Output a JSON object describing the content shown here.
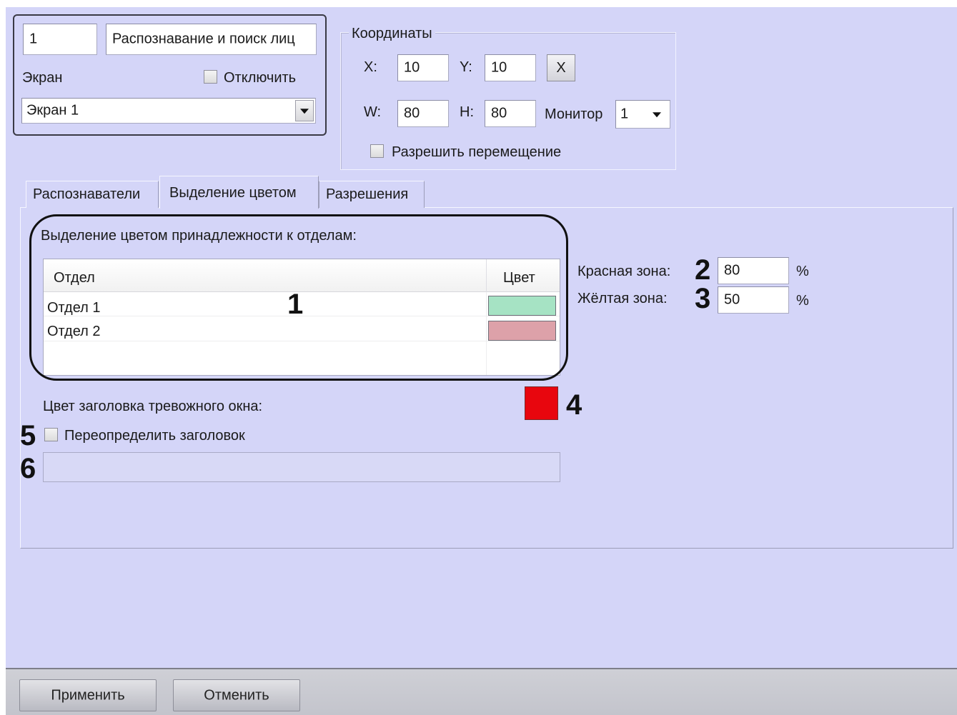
{
  "object": {
    "id": "1",
    "name": "Распознавание и поиск лиц",
    "screen_label": "Экран",
    "disable_label": "Отключить",
    "screen_value": "Экран 1"
  },
  "coords": {
    "title": "Координаты",
    "x_label": "X:",
    "x_value": "10",
    "y_label": "Y:",
    "y_value": "10",
    "clear_label": "X",
    "w_label": "W:",
    "w_value": "80",
    "h_label": "H:",
    "h_value": "80",
    "monitor_label": "Монитор",
    "monitor_value": "1",
    "allow_move_label": "Разрешить перемещение"
  },
  "tabs": [
    {
      "label": "Распознаватели",
      "active": false
    },
    {
      "label": "Выделение цветом",
      "active": true
    },
    {
      "label": "Разрешения",
      "active": false
    }
  ],
  "color_tab": {
    "dept_section_label": "Выделение цветом принадлежности к отделам:",
    "table": {
      "headers": [
        "Отдел",
        "Цвет"
      ],
      "rows": [
        {
          "dept": "Отдел 1",
          "color": "#a6e3c4"
        },
        {
          "dept": "Отдел 2",
          "color": "#dda1a9"
        }
      ]
    },
    "red_zone_label": "Красная зона:",
    "red_zone_value": "80",
    "yellow_zone_label": "Жёлтая зона:",
    "yellow_zone_value": "50",
    "percent": "%",
    "alarm_header_label": "Цвет заголовка тревожного окна:",
    "alarm_header_color": "#e8060e",
    "override_label": "Переопределить заголовок",
    "override_value": ""
  },
  "callouts": [
    "1",
    "2",
    "3",
    "4",
    "5",
    "6"
  ],
  "buttons": {
    "apply": "Применить",
    "cancel": "Отменить"
  },
  "colors": {
    "panel_bg": "#d4d5f8",
    "callout_outline": "#111111"
  }
}
